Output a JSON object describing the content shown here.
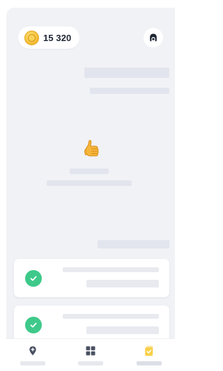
{
  "header": {
    "coin_balance": "15 320",
    "coin_icon": "coin-icon",
    "avatar_icon": "avatar-icon"
  },
  "feedback": {
    "emoji": "thumbs-up-emoji"
  },
  "cards": [
    {
      "status_icon": "check-icon",
      "completed": true
    },
    {
      "status_icon": "check-icon",
      "completed": true
    }
  ],
  "tabbar": {
    "tabs": [
      {
        "icon": "map-pin-icon",
        "active": false
      },
      {
        "icon": "grid-icon",
        "active": false
      },
      {
        "icon": "lesson-card-icon",
        "active": true
      }
    ]
  },
  "colors": {
    "background": "#f1f2f6",
    "check_green": "#3ec98a",
    "coin_gold": "#f6c43d",
    "active_tab_yellow": "#f7d14a",
    "text_dark": "#1e2533"
  }
}
